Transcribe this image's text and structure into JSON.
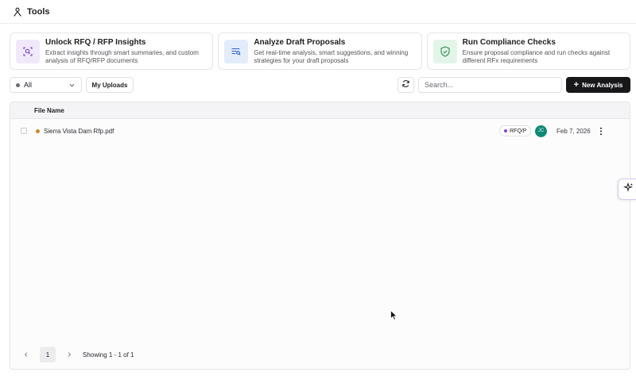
{
  "header": {
    "title": "Tools",
    "icon": "tools-icon"
  },
  "cards": [
    {
      "title": "Unlock RFQ / RFP Insights",
      "desc_line1": "Extract insights through smart summaries, and custom",
      "desc_line2": "analysis of RFQ/RFP documents",
      "icon": "document-search-icon",
      "bg": "#f1e9fb",
      "color": "#7a3fc4"
    },
    {
      "title": "Analyze Draft Proposals",
      "desc_line1": "Get real-time analysis, smart suggestions, and winning",
      "desc_line2": "strategies for your draft proposals",
      "icon": "list-search-icon",
      "bg": "#e3ecfb",
      "color": "#2f5fc4"
    },
    {
      "title": "Run Compliance Checks",
      "desc_line1": "Ensure proposal compliance and run checks against",
      "desc_line2": "different RFx requirements",
      "icon": "shield-check-icon",
      "bg": "#e2f5e8",
      "color": "#2f8a4f"
    }
  ],
  "toolbar": {
    "filter_value": "All",
    "my_uploads_label": "My Uploads",
    "search_placeholder": "Search...",
    "new_analysis_label": "New Analysis"
  },
  "table": {
    "column_file_name": "File Name",
    "rows": [
      {
        "file_name": "Sierra Vista Dam Rfp.pdf",
        "type_badge": "RFQ/P",
        "avatar_initials": "JC",
        "date": "Feb 7, 2026",
        "status_color": "#c68a2b",
        "badge_color": "#8b3fd9",
        "avatar_color": "#0f8a77"
      }
    ]
  },
  "pagination": {
    "current_page": "1",
    "showing_text": "Showing 1 - 1 of 1"
  },
  "colors": {
    "primary_button": "#18181b",
    "border": "#e6e6ea"
  }
}
